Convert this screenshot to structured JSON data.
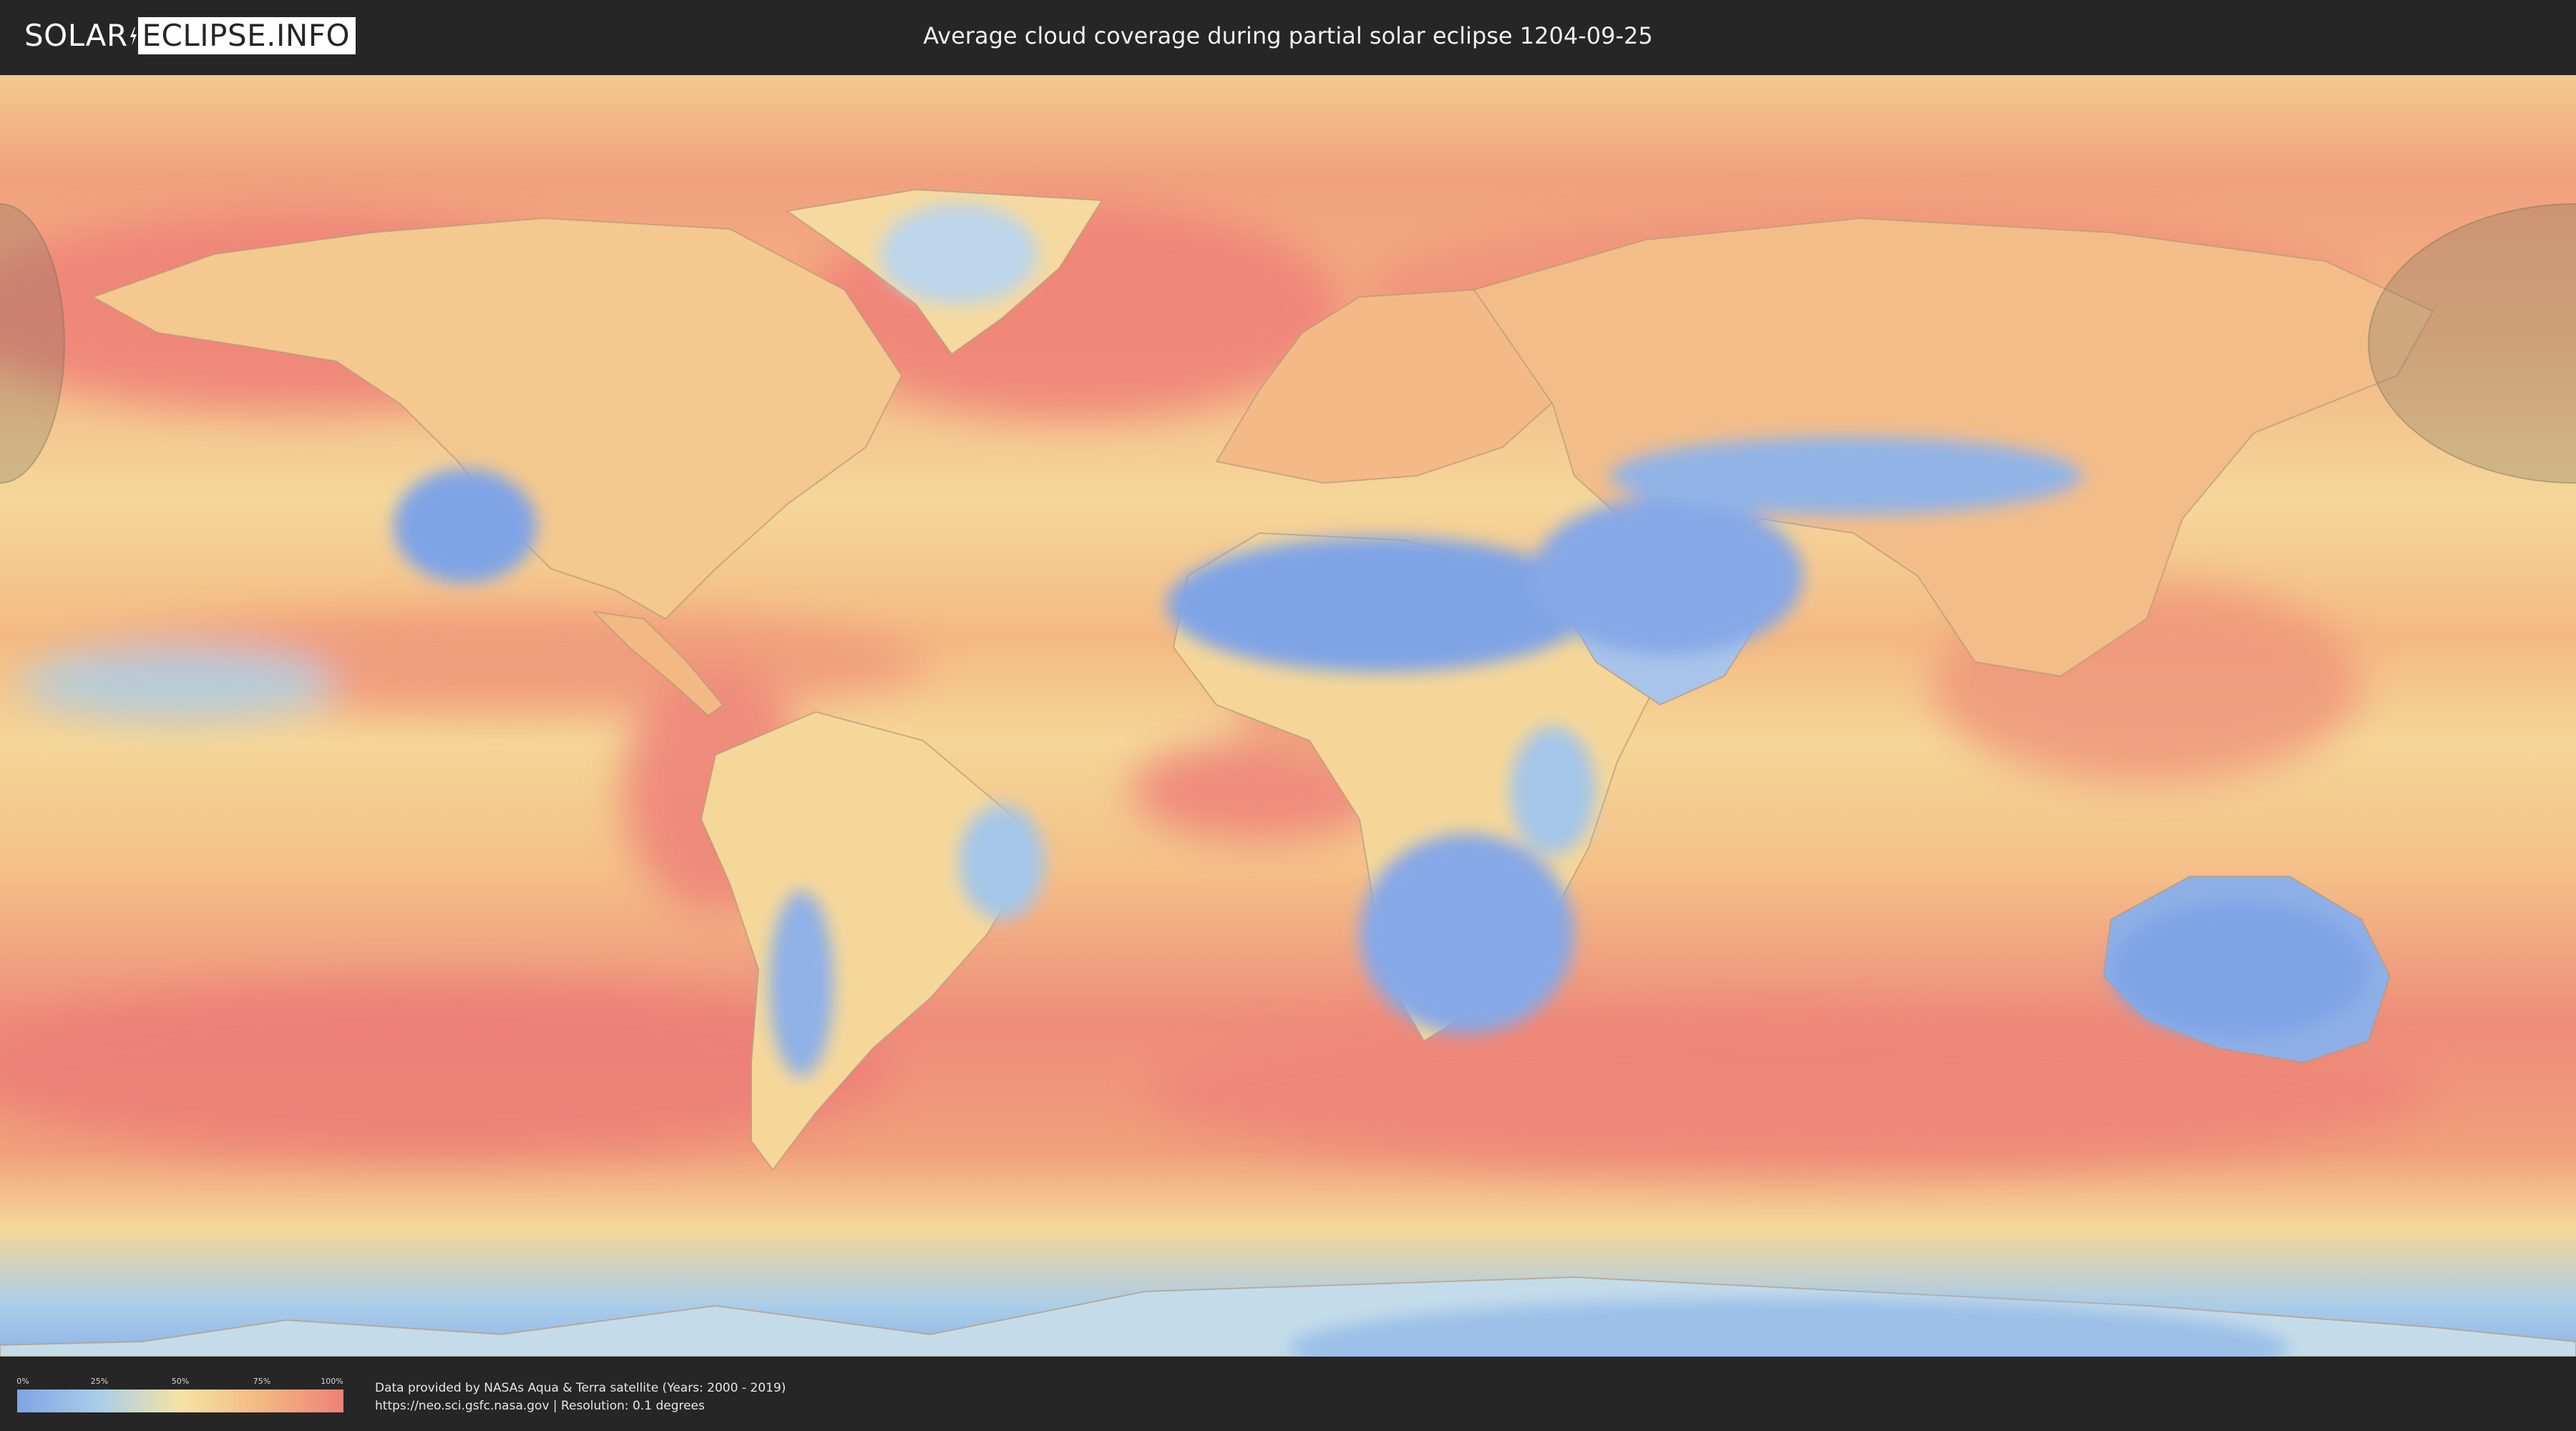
{
  "header": {
    "logo_part1": "SOLAR",
    "logo_part2": "ECLIPSE.INFO",
    "title": "Average cloud coverage during partial solar eclipse 1204-09-25"
  },
  "legend": {
    "ticks": [
      "0%",
      "25%",
      "50%",
      "75%",
      "100%"
    ],
    "colors": [
      "#7fa4e6",
      "#aacde8",
      "#f5e3a4",
      "#f4b882",
      "#ef8178"
    ]
  },
  "credits": {
    "line1": "Data provided by NASAs Aqua & Terra satellite (Years: 2000 - 2019)",
    "line2": "https://neo.sci.gsfc.nasa.gov | Resolution: 0.1 degrees"
  },
  "map": {
    "cloud_colors": {
      "clear": "#7fa4e6",
      "low": "#aacde8",
      "mid": "#f5e3a4",
      "high": "#f4b882",
      "overcast": "#ef8178"
    },
    "eclipse_shadow_color": "#6f6f5a"
  }
}
